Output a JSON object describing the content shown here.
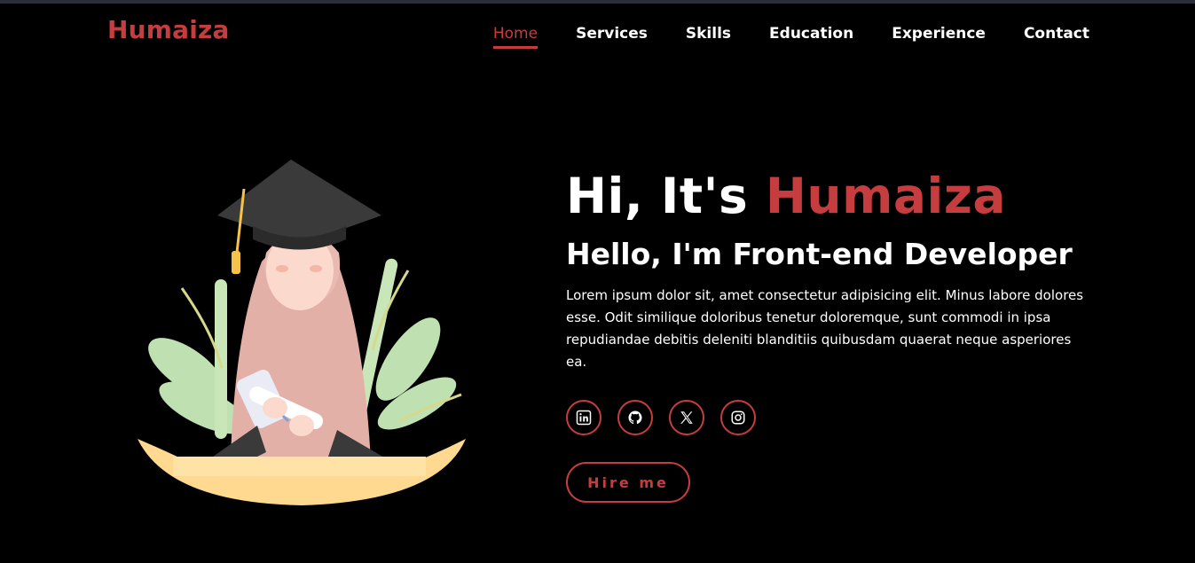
{
  "header": {
    "logo": "Humaiza",
    "nav": [
      {
        "label": "Home",
        "active": true
      },
      {
        "label": "Services"
      },
      {
        "label": "Skills"
      },
      {
        "label": "Education"
      },
      {
        "label": "Experience"
      },
      {
        "label": "Contact"
      }
    ]
  },
  "hero": {
    "greeting_prefix": "Hi, It's ",
    "greeting_name": "Humaiza",
    "subtitle": "Hello, I'm Front-end Developer",
    "description": "Lorem ipsum dolor sit, amet consectetur adipisicing elit. Minus labore dolores esse. Odit similique doloribus tenetur doloremque, sunt commodi in ipsa repudiandae debitis deleniti blanditiis quibusdam quaerat neque asperiores ea.",
    "socials": [
      "linkedin-icon",
      "github-icon",
      "x-icon",
      "instagram-icon"
    ],
    "cta_label": "Hire me"
  },
  "colors": {
    "accent": "#c63d3f",
    "background": "#000000",
    "text": "#ffffff"
  }
}
